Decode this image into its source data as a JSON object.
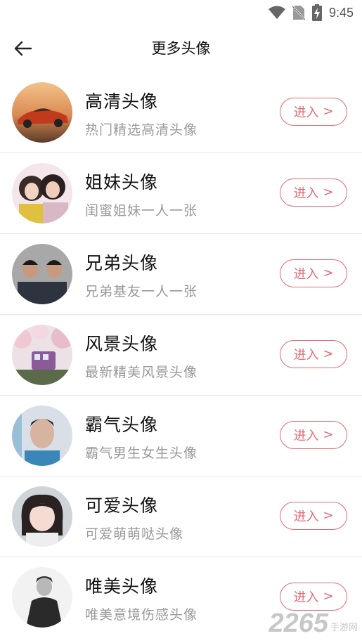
{
  "status_bar": {
    "time": "9:45"
  },
  "header": {
    "title": "更多头像"
  },
  "items": [
    {
      "title": "高清头像",
      "subtitle": "热门精选高清头像",
      "button": "进入",
      "icon": "sports-car-avatar"
    },
    {
      "title": "姐妹头像",
      "subtitle": "闺蜜姐妹一人一张",
      "button": "进入",
      "icon": "sisters-avatar"
    },
    {
      "title": "兄弟头像",
      "subtitle": "兄弟基友一人一张",
      "button": "进入",
      "icon": "brothers-avatar"
    },
    {
      "title": "风景头像",
      "subtitle": "最新精美风景头像",
      "button": "进入",
      "icon": "train-scenery-avatar"
    },
    {
      "title": "霸气头像",
      "subtitle": "霸气男生女生头像",
      "button": "进入",
      "icon": "cool-man-avatar"
    },
    {
      "title": "可爱头像",
      "subtitle": "可爱萌萌哒头像",
      "button": "进入",
      "icon": "cute-girl-avatar"
    },
    {
      "title": "唯美头像",
      "subtitle": "唯美意境伤感头像",
      "button": "进入",
      "icon": "bw-aesthetic-avatar"
    }
  ],
  "watermark": {
    "number": "2265",
    "text": "手游网"
  },
  "colors": {
    "accent": "#e26b75",
    "subtitle": "#999999",
    "divider": "#e6e6e6"
  }
}
